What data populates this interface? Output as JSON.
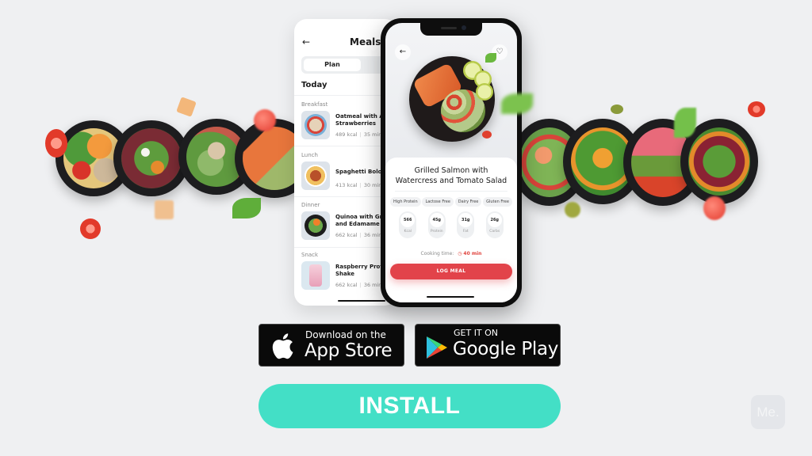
{
  "meals_screen": {
    "title": "Meals",
    "back_icon": "arrow-left-icon",
    "segment": {
      "active": "Plan"
    },
    "section_title": "Today",
    "meals": [
      {
        "category": "Breakfast",
        "name_line1": "Oatmeal with Ap",
        "name_line2": "Strawberries",
        "kcal": "489 kcal",
        "time": "35 min"
      },
      {
        "category": "Lunch",
        "name_line1": "Spaghetti Bologn",
        "name_line2": "",
        "kcal": "413 kcal",
        "time": "30 min"
      },
      {
        "category": "Dinner",
        "name_line1": "Quinoa with Gree",
        "name_line2": "and Edamame Be",
        "kcal": "662 kcal",
        "time": "36 min"
      },
      {
        "category": "Snack",
        "name_line1": "Raspberry Protein",
        "name_line2": "Shake",
        "kcal": "662 kcal",
        "time": "36 min"
      }
    ]
  },
  "detail_screen": {
    "back_icon": "arrow-left-icon",
    "favorite_icon": "heart-icon",
    "title_line1": "Grilled Salmon with",
    "title_line2": "Watercress and Tomato Salad",
    "tags": [
      "High Protein",
      "Lactose Free",
      "Dairy Free",
      "Gluten Free"
    ],
    "macros": [
      {
        "value": "566",
        "label": "Kcal"
      },
      {
        "value": "45g",
        "label": "Protein"
      },
      {
        "value": "31g",
        "label": "Fat"
      },
      {
        "value": "26g",
        "label": "Carbs"
      }
    ],
    "cooking_label": "Cooking time:",
    "cooking_time": "40 min",
    "log_button": "LOG MEAL"
  },
  "store_badges": {
    "apple": {
      "small": "Download on the",
      "big": "App Store"
    },
    "google": {
      "small": "GET IT ON",
      "big": "Google Play"
    }
  },
  "install_button": "INSTALL",
  "brand_logo": "Me.",
  "colors": {
    "background": "#eff0f2",
    "accent_red": "#e2434a",
    "install_teal": "#43dfc6"
  }
}
